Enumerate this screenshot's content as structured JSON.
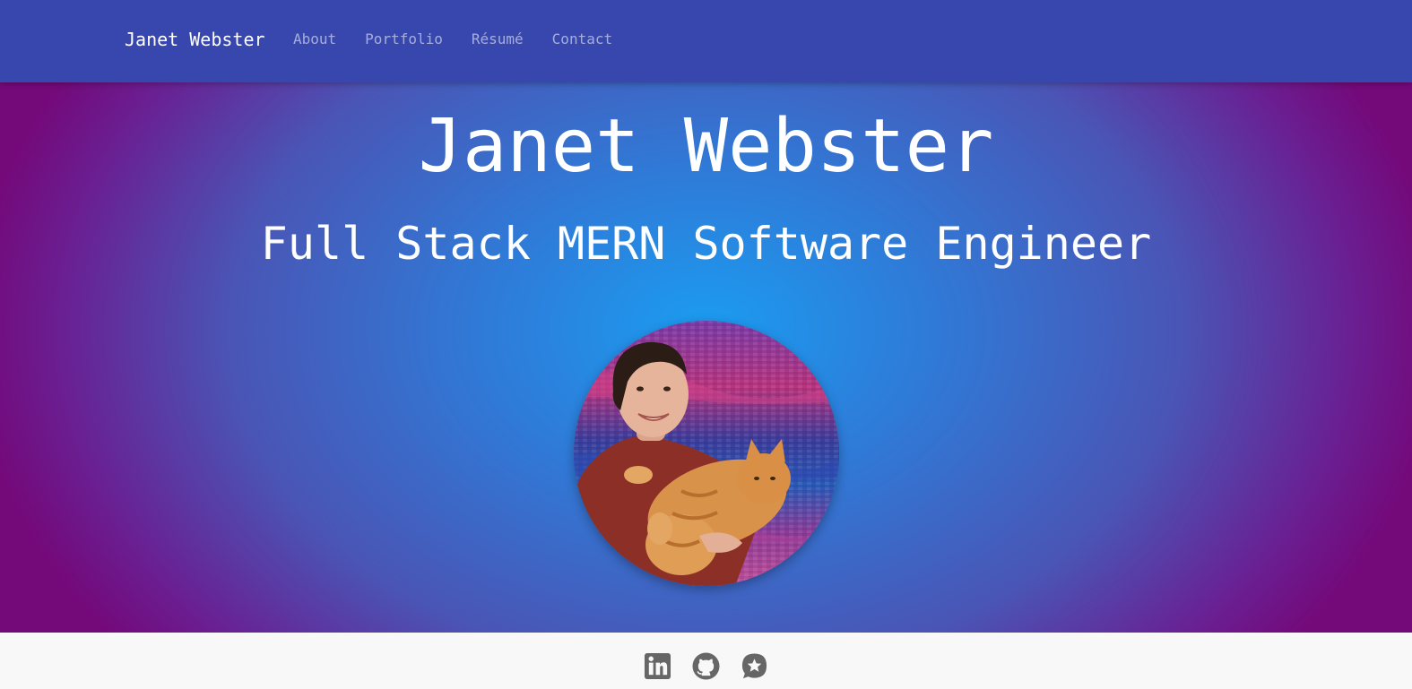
{
  "nav": {
    "brand": "Janet Webster",
    "links": [
      {
        "label": "About"
      },
      {
        "label": "Portfolio"
      },
      {
        "label": "Résumé"
      },
      {
        "label": "Contact"
      }
    ]
  },
  "hero": {
    "title": "Janet Webster",
    "subtitle": "Full Stack MERN Software Engineer",
    "photo_icon": "profile-photo"
  },
  "footer": {
    "social_icons": [
      "linkedin-icon",
      "github-icon",
      "badge-star-icon"
    ]
  },
  "colors": {
    "navbar": "#3847ad",
    "hero_center": "#1b9cf0",
    "hero_edge": "#74097a",
    "footer_bg": "#f8f8f8",
    "icon": "#666666"
  }
}
